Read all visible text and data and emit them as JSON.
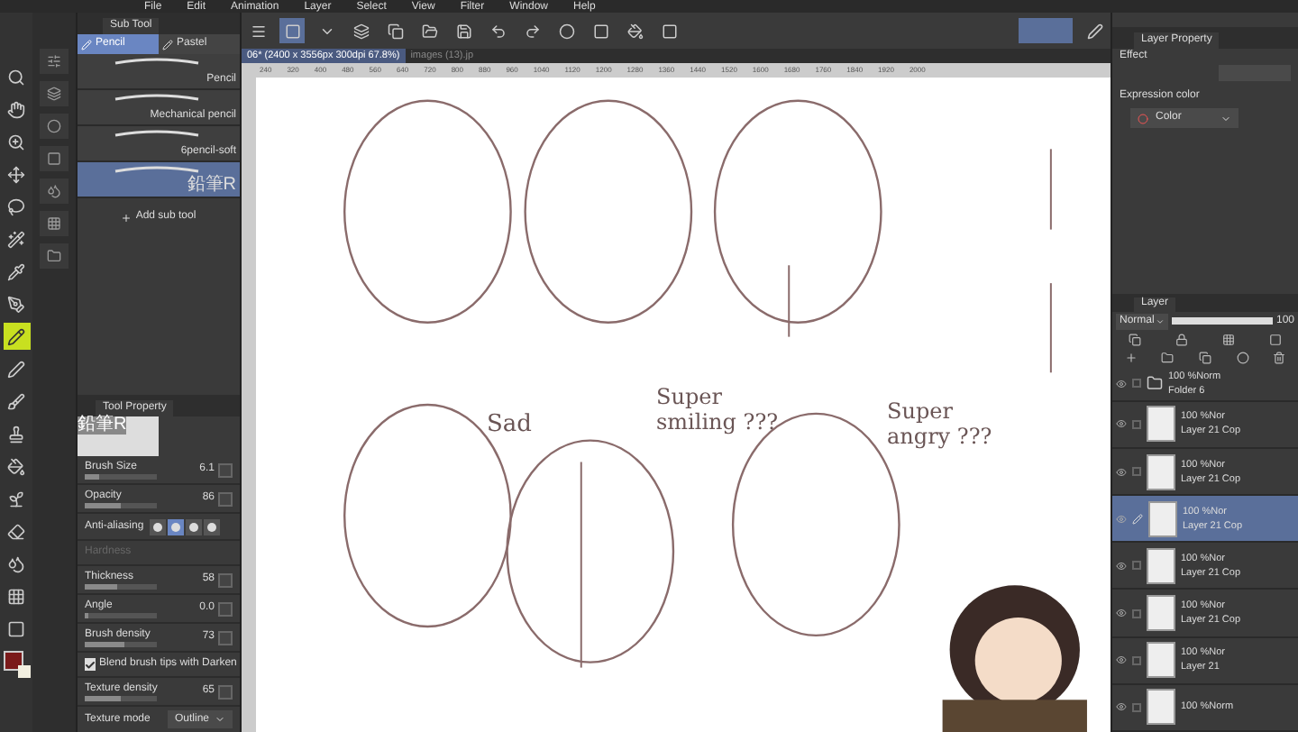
{
  "menu": [
    "File",
    "Edit",
    "Animation",
    "Layer",
    "Select",
    "View",
    "Filter",
    "Window",
    "Help"
  ],
  "tools": [
    {
      "selected": false
    },
    {
      "selected": false
    },
    {
      "selected": false
    },
    {
      "selected": false
    },
    {
      "selected": false
    },
    {
      "selected": false
    },
    {
      "selected": false
    },
    {
      "selected": false
    },
    {
      "selected": true
    },
    {
      "selected": false
    },
    {
      "selected": false
    },
    {
      "selected": false
    },
    {
      "selected": false
    },
    {
      "selected": false
    },
    {
      "selected": false
    },
    {
      "selected": false
    },
    {
      "selected": false
    },
    {
      "selected": false
    }
  ],
  "sub_tool": {
    "title": "Sub Tool",
    "groups": [
      {
        "label": "Pencil",
        "selected": true
      },
      {
        "label": "Pastel",
        "selected": false
      }
    ],
    "items": [
      {
        "name": "Pencil",
        "selected": false
      },
      {
        "name": "Mechanical pencil",
        "selected": false
      },
      {
        "name": "6pencil-soft",
        "selected": false
      },
      {
        "name": "鉛筆R",
        "selected": true
      }
    ],
    "add_label": "Add sub tool"
  },
  "tool_property": {
    "title": "Tool Property",
    "preset": "鉛筆R",
    "rows": [
      {
        "kind": "slider",
        "label": "Brush Size",
        "value": "6.1",
        "level": 0.2
      },
      {
        "kind": "slider",
        "label": "Opacity",
        "value": "86",
        "level": 0.5
      },
      {
        "kind": "choice",
        "label": "Anti-aliasing",
        "options": [
          {
            "selected": false
          },
          {
            "selected": true
          },
          {
            "selected": false
          },
          {
            "selected": false
          }
        ]
      },
      {
        "kind": "disabled",
        "label": "Hardness"
      },
      {
        "kind": "slider",
        "label": "Thickness",
        "value": "58",
        "level": 0.45
      },
      {
        "kind": "slider",
        "label": "Angle",
        "value": "0.0",
        "level": 0
      },
      {
        "kind": "slider",
        "label": "Brush density",
        "value": "73",
        "level": 0.55
      },
      {
        "kind": "check",
        "label": "Blend brush tips with Darken",
        "checked": true
      },
      {
        "kind": "slider",
        "label": "Texture density",
        "value": "65",
        "level": 0.5
      },
      {
        "kind": "select",
        "label": "Texture mode",
        "value": "Outline"
      }
    ]
  },
  "toolbar": {
    "pressure_on": true
  },
  "tabs": [
    {
      "label": "06* (2400 x 3556px 300dpi 67.8%)",
      "selected": true
    },
    {
      "label": "images (13).jp",
      "selected": false
    }
  ],
  "ruler": [
    "240",
    "320",
    "400",
    "480",
    "560",
    "640",
    "720",
    "800",
    "880",
    "960",
    "1040",
    "1120",
    "1200",
    "1280",
    "1360",
    "1440",
    "1520",
    "1600",
    "1680",
    "1760",
    "1840",
    "1920",
    "2000"
  ],
  "canvas_labels": [
    "Sad",
    "Super smiling ???",
    "Super angry ???"
  ],
  "layer_property": {
    "title": "Layer Property",
    "effect": "Effect",
    "expression_label": "Expression color",
    "expression_value": "Color"
  },
  "layer_panel": {
    "title": "Layer",
    "blend": "Normal",
    "opacity": "100",
    "layers": [
      {
        "kind": "folder",
        "mode": "100 %Norm",
        "name": "Folder 6",
        "selected": false
      },
      {
        "kind": "layer",
        "mode": "100 %Nor",
        "name": "Layer 21 Cop",
        "selected": false
      },
      {
        "kind": "layer",
        "mode": "100 %Nor",
        "name": "Layer 21 Cop",
        "selected": false
      },
      {
        "kind": "layer",
        "mode": "100 %Nor",
        "name": "Layer 21 Cop",
        "selected": true
      },
      {
        "kind": "layer",
        "mode": "100 %Nor",
        "name": "Layer 21 Cop",
        "selected": false
      },
      {
        "kind": "layer",
        "mode": "100 %Nor",
        "name": "Layer 21 Cop",
        "selected": false
      },
      {
        "kind": "layer",
        "mode": "100 %Nor",
        "name": "Layer 21",
        "selected": false
      },
      {
        "kind": "layer",
        "mode": "100 %Norm",
        "selected": false
      }
    ]
  }
}
